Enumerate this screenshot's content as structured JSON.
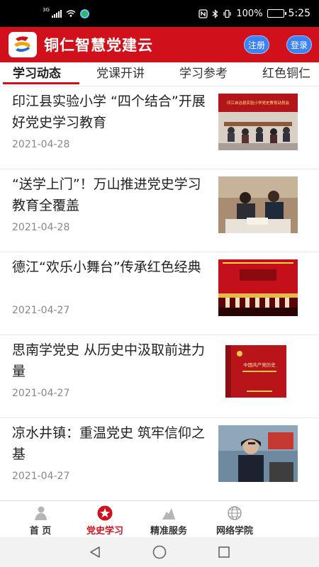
{
  "status_bar": {
    "network": "3G",
    "battery_text": "100%",
    "battery_level": 1.0,
    "time": "5:25",
    "icons": [
      "signal-icon",
      "wifi-icon",
      "app-notification-icon",
      "nfc-icon",
      "bluetooth-icon",
      "vibrate-icon",
      "battery-icon"
    ]
  },
  "header": {
    "title": "铜仁智慧党建云",
    "register_label": "注册",
    "login_label": "登录",
    "brand_color": "#d0111b",
    "button_color": "#3b82f6"
  },
  "tabs": [
    {
      "label": "学习动态",
      "active": true
    },
    {
      "label": "党课开讲",
      "active": false
    },
    {
      "label": "学习参考",
      "active": false
    },
    {
      "label": "红色铜仁",
      "active": false
    }
  ],
  "news": [
    {
      "title": "印江县实验小学 “四个结合”开展好党史学习教育",
      "date": "2021-04-28",
      "thumb_text": "印江自治县实验小学党史教育动员会"
    },
    {
      "title": "“送学上门”！万山推进党史学习教育全覆盖",
      "date": "2021-04-28"
    },
    {
      "title": "德江“欢乐小舞台”传承红色经典",
      "date": "2021-04-27"
    },
    {
      "title": "思南学党史 从历史中汲取前进力量",
      "date": "2021-04-27",
      "thumb_text": "中国共产党历史"
    },
    {
      "title": "凉水井镇：重温党史 筑牢信仰之基",
      "date": "2021-04-27"
    }
  ],
  "bottom_nav": [
    {
      "label": "首 页",
      "icon": "home-person-icon",
      "active": false
    },
    {
      "label": "党史学习",
      "icon": "star-badge-icon",
      "active": true
    },
    {
      "label": "精准服务",
      "icon": "service-icon",
      "active": false
    },
    {
      "label": "网络学院",
      "icon": "globe-icon",
      "active": false
    }
  ],
  "system_nav": [
    "back-icon",
    "home-icon",
    "recents-icon"
  ]
}
